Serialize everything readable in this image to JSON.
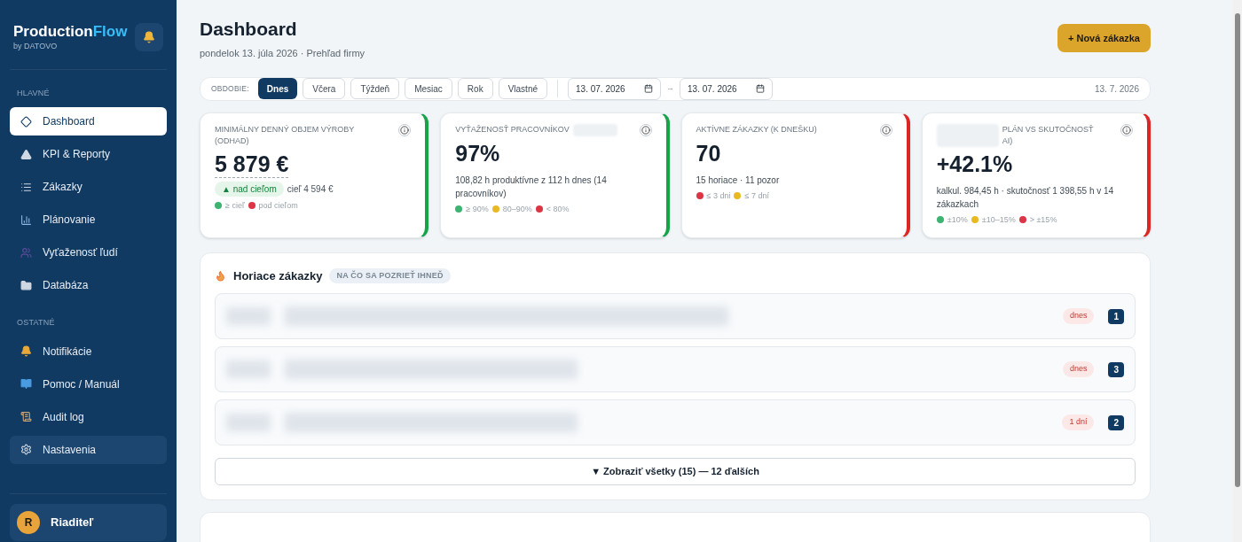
{
  "sidebar": {
    "brand": {
      "name": "Production",
      "accent": "Flow",
      "by": "by DATOVO"
    },
    "sections": [
      {
        "title": "HLAVNÉ",
        "items": [
          {
            "label": "Dashboard",
            "selected": true,
            "hovered": false
          },
          {
            "label": "KPI & Reporty",
            "selected": false,
            "hovered": false
          },
          {
            "label": "Zákazky",
            "selected": false,
            "hovered": false
          },
          {
            "label": "Plánovanie",
            "selected": false,
            "hovered": false
          },
          {
            "label": "Vyťaženosť ľudí",
            "selected": false,
            "hovered": false
          },
          {
            "label": "Databáza",
            "selected": false,
            "hovered": false
          }
        ]
      },
      {
        "title": "OSTATNÉ",
        "items": [
          {
            "label": "Notifikácie",
            "selected": false,
            "hovered": false
          },
          {
            "label": "Pomoc / Manuál",
            "selected": false,
            "hovered": false
          },
          {
            "label": "Audit log",
            "selected": false,
            "hovered": false
          },
          {
            "label": "Nastavenia",
            "selected": false,
            "hovered": true
          }
        ]
      }
    ],
    "user": {
      "initial": "R",
      "name": "Riaditeľ"
    }
  },
  "header": {
    "title": "Dashboard",
    "subtitle": "pondelok 13. júla 2026 · Prehľad firmy",
    "action": "+ Nová zákazka"
  },
  "filter": {
    "label": "OBDOBIE:",
    "periods": [
      {
        "label": "Dnes",
        "selected": true
      },
      {
        "label": "Včera",
        "selected": false
      },
      {
        "label": "Týždeň",
        "selected": false
      },
      {
        "label": "Mesiac",
        "selected": false
      },
      {
        "label": "Rok",
        "selected": false
      },
      {
        "label": "Vlastné",
        "selected": false
      }
    ],
    "date_from": "13. 07. 2026",
    "separator": "→",
    "date_to": "13. 07. 2026",
    "current_date": "13. 7. 2026"
  },
  "kpis": [
    {
      "title": [
        "MINIMÁLNY DENNÝ OBJEM VÝROBY",
        "(ODHAD)"
      ],
      "value": "5 879 €",
      "badge": "▲ nad cieľom",
      "target": "cieľ 4 594 €",
      "legend": [
        {
          "color": "#3cb371",
          "label": "≥ cieľ"
        },
        {
          "color": "#dc3545",
          "label": "pod cieľom"
        }
      ],
      "color": "#16a34a"
    },
    {
      "title": [
        "VYŤAŽENOSŤ PRACOVNÍKOV"
      ],
      "value": "97%",
      "details": [
        "108,82 h produktívne z 112 h dnes (14 pracovníkov)"
      ],
      "legend": [
        {
          "color": "#3cb371",
          "label": "≥ 90%"
        },
        {
          "color": "#e8b923",
          "label": "80–90%"
        },
        {
          "color": "#dc3545",
          "label": "< 80%"
        }
      ],
      "color": "#16a34a"
    },
    {
      "title": [
        "AKTÍVNE ZÁKAZKY (K DNEŠKU)"
      ],
      "value": "70",
      "details": [
        "15 horiace · 11 pozor"
      ],
      "legend": [
        {
          "color": "#dc3545",
          "label": "≤ 3 dni"
        },
        {
          "color": "#e8b923",
          "label": "≤ 7 dní"
        }
      ],
      "color": "#dc2626"
    },
    {
      "title": [
        "PLÁN VS SKUTOČNOSŤ",
        "AI)"
      ],
      "value": "+42.1%",
      "details": [
        "kalkul. 984,45 h · skutočnosť 1 398,55 h v 14 zákazkach"
      ],
      "legend": [
        {
          "color": "#3cb371",
          "label": "±10%"
        },
        {
          "color": "#e8b923",
          "label": "±10–15%"
        },
        {
          "color": "#dc3545",
          "label": "> ±15%"
        }
      ],
      "color": "#dc2626"
    }
  ],
  "hot": {
    "title": "Horiace zákazky",
    "tag": "NA ČO SA POZRIEŤ IHNEĎ",
    "rows": [
      {
        "due": "dnes",
        "count": "1"
      },
      {
        "due": "dnes",
        "count": "3"
      },
      {
        "due": "1 dní",
        "count": "2"
      }
    ],
    "show_all": "▼ Zobraziť všetky (15) — 12 ďalších"
  }
}
